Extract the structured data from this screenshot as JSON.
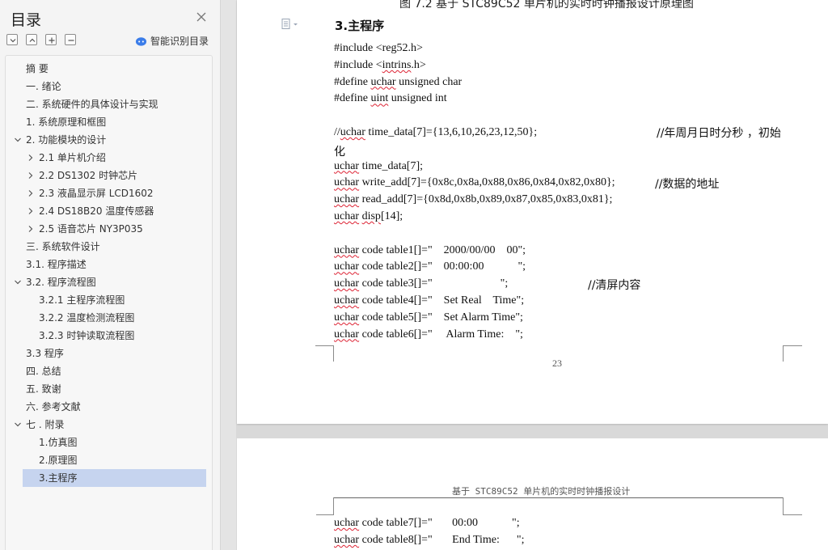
{
  "sidebar": {
    "title": "目录",
    "ai_label": "智能识别目录",
    "toc": [
      {
        "label": "摘  要",
        "level": 0
      },
      {
        "label": "一. 绪论",
        "level": 0
      },
      {
        "label": "二. 系统硬件的具体设计与实现",
        "level": 0
      },
      {
        "label": "1. 系统原理和框图",
        "level": 0
      },
      {
        "label": "2. 功能模块的设计",
        "level": 0,
        "chevron": "expanded"
      },
      {
        "label": "2.1  单片机介绍",
        "level": 1,
        "chevron": "collapsed"
      },
      {
        "label": "2.2    DS1302 时钟芯片",
        "level": 1,
        "chevron": "collapsed"
      },
      {
        "label": "2.3    液晶显示屏 LCD1602",
        "level": 1,
        "chevron": "collapsed"
      },
      {
        "label": "2.4 DS18B20 温度传感器",
        "level": 1,
        "chevron": "collapsed"
      },
      {
        "label": "2.5 语音芯片 NY3P035",
        "level": 1,
        "chevron": "collapsed"
      },
      {
        "label": "三. 系统软件设计",
        "level": 0
      },
      {
        "label": "3.1. 程序描述",
        "level": 0
      },
      {
        "label": "3.2. 程序流程图",
        "level": 0,
        "chevron": "expanded"
      },
      {
        "label": "3.2.1  主程序流程图",
        "level": 1
      },
      {
        "label": "3.2.2  温度检测流程图",
        "level": 1
      },
      {
        "label": "3.2.3  时钟读取流程图",
        "level": 1
      },
      {
        "label": "3.3  程序",
        "level": 0
      },
      {
        "label": "四. 总结",
        "level": 0
      },
      {
        "label": "五. 致谢",
        "level": 0
      },
      {
        "label": "六. 参考文献",
        "level": 0
      },
      {
        "label": "七 . 附录",
        "level": 0,
        "chevron": "expanded"
      },
      {
        "label": "1.仿真图",
        "level": 1
      },
      {
        "label": "2.原理图",
        "level": 1
      },
      {
        "label": "3.主程序",
        "level": 1,
        "selected": true
      }
    ]
  },
  "document": {
    "page1": {
      "figure_caption": "图 7.2 基于 STC89C52 单片机的实时时钟播报设计原理图",
      "section_heading": "3.主程序",
      "page_number": "23",
      "code_lines": [
        [
          {
            "t": "#include <reg52.h>"
          }
        ],
        [
          {
            "t": "#include <"
          },
          {
            "t": "intrins",
            "s": 1
          },
          {
            "t": ".h>"
          }
        ],
        [
          {
            "t": "#define "
          },
          {
            "t": "uchar",
            "s": 1
          },
          {
            "t": " unsigned char"
          }
        ],
        [
          {
            "t": "#define "
          },
          {
            "t": "uint",
            "s": 1
          },
          {
            "t": " unsigned int"
          }
        ],
        [],
        [
          {
            "t": "//"
          },
          {
            "t": "uchar",
            "s": 1
          },
          {
            "t": " time_data[7]={13,6,10,26,23,12,50};"
          }
        ],
        [
          {
            "t": "化",
            "c": 1
          }
        ],
        [
          {
            "t": "uchar",
            "s": 1
          },
          {
            "t": " time_data[7];"
          }
        ],
        [
          {
            "t": "uchar",
            "s": 1
          },
          {
            "t": " write_add[7]={0x8c,0x8a,0x88,0x86,0x84,0x82,0x80};"
          }
        ],
        [
          {
            "t": "uchar",
            "s": 1
          },
          {
            "t": " read_add[7]={0x8d,0x8b,0x89,0x87,0x85,0x83,0x81};"
          }
        ],
        [
          {
            "t": "uchar",
            "s": 1
          },
          {
            "t": " "
          },
          {
            "t": "disp",
            "s": 1
          },
          {
            "t": "[14];"
          }
        ],
        [],
        [
          {
            "t": "uchar",
            "s": 1
          },
          {
            "t": " code table1[]=\"    2000/00/00    00\";"
          }
        ],
        [
          {
            "t": "uchar",
            "s": 1
          },
          {
            "t": " code table2[]=\"    00:00:00            \";"
          }
        ],
        [
          {
            "t": "uchar",
            "s": 1
          },
          {
            "t": " code table3[]=\"                        \";"
          }
        ],
        [
          {
            "t": "uchar",
            "s": 1
          },
          {
            "t": " code table4[]=\"    Set Real    Time\";"
          }
        ],
        [
          {
            "t": "uchar",
            "s": 1
          },
          {
            "t": " code table5[]=\"    Set Alarm Time\";"
          }
        ],
        [
          {
            "t": "uchar",
            "s": 1
          },
          {
            "t": " code table6[]=\"     Alarm Time:    \";"
          }
        ]
      ],
      "comment_1": "//年周月日时分秒 ，初始",
      "comment_2": "//数据的地址",
      "comment_3": "//清屏内容"
    },
    "page2": {
      "running_header": "基于 STC89C52 单片机的实时时钟播报设计",
      "code_lines": [
        [
          {
            "t": "uchar",
            "s": 1
          },
          {
            "t": " code table7[]=\"       00:00            \";"
          }
        ],
        [
          {
            "t": "uchar",
            "s": 1
          },
          {
            "t": " code table8[]=\"       End Time:      \";"
          }
        ]
      ]
    }
  },
  "colors": {
    "selected_bg": "#c6d4ef",
    "ai_icon": "#3b7de9",
    "spell_underline": "#d23"
  }
}
